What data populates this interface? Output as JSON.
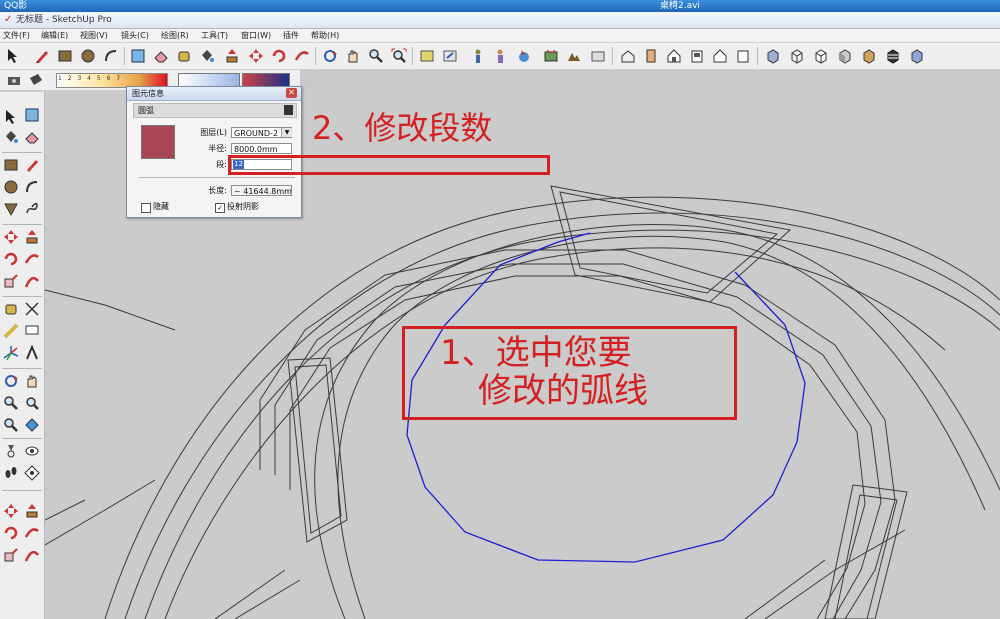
{
  "player": {
    "name": "QQ影音",
    "file_title": "桌椅2.avi"
  },
  "app": {
    "title": "无标题 - SketchUp Pro"
  },
  "menu": {
    "items": [
      "文件(F)",
      "编辑(E)",
      "视图(V)",
      "镜头(C)",
      "绘图(R)",
      "工具(T)",
      "窗口(W)",
      "插件",
      "帮助(H)"
    ]
  },
  "style_toolbar": {
    "scale_numbers": "1 2 3 4 5 6 7"
  },
  "entity_info": {
    "title": "图元信息",
    "entity_type": "圆弧",
    "layer_label": "图层(L)",
    "layer_value": "GROUND-2",
    "radius_label": "半径:",
    "radius_value": "8000.0mm",
    "segments_label": "段:",
    "segments_value": "12",
    "length_label": "长度:",
    "length_value": "~ 41644.8mm",
    "hidden_label": "隐藏",
    "cast_shadows_label": "投射阴影",
    "hidden_checked": false,
    "cast_shadows_checked": true,
    "material_color": "#a74554"
  },
  "annotations": {
    "step2": "2、修改段数",
    "step1_line1": "1、选中您要",
    "step1_line2": "修改的弧线",
    "color": "#d42020"
  },
  "colors": {
    "selected_arc": "#1f1fd2",
    "edges": "#3a3a3a",
    "viewport_bg": "#cbcbcb"
  }
}
